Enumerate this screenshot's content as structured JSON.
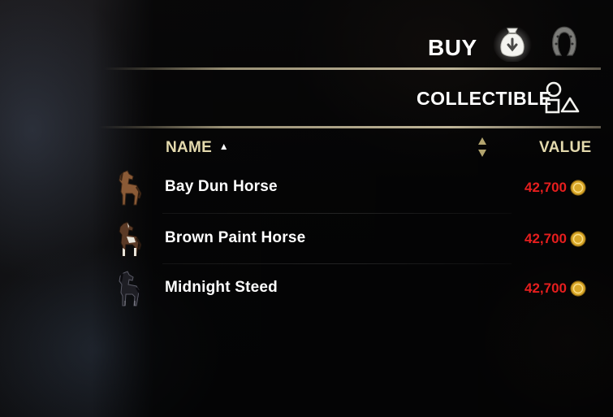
{
  "tabs": {
    "buy": {
      "label": "BUY",
      "icon": "money-bag-icon"
    },
    "stable": {
      "icon": "horseshoe-icon"
    },
    "collectible": {
      "label": "COLLECTIBLE",
      "icon": "shapes-icon"
    }
  },
  "columns": {
    "name": "NAME",
    "name_sort_indicator": "▲",
    "value": "VALUE"
  },
  "items": [
    {
      "name": "Bay Dun Horse",
      "price": "42,700",
      "icon": "horse-bay-dun-icon",
      "coat": "#8a5a36"
    },
    {
      "name": "Brown Paint Horse",
      "price": "42,700",
      "icon": "horse-brown-paint-icon",
      "coat": "#5b3a26"
    },
    {
      "name": "Midnight Steed",
      "price": "42,700",
      "icon": "horse-midnight-icon",
      "coat": "#1e1e24"
    }
  ],
  "colors": {
    "price": "#e61e1e",
    "header": "#e3d9ad",
    "coin": "#d9a728"
  }
}
